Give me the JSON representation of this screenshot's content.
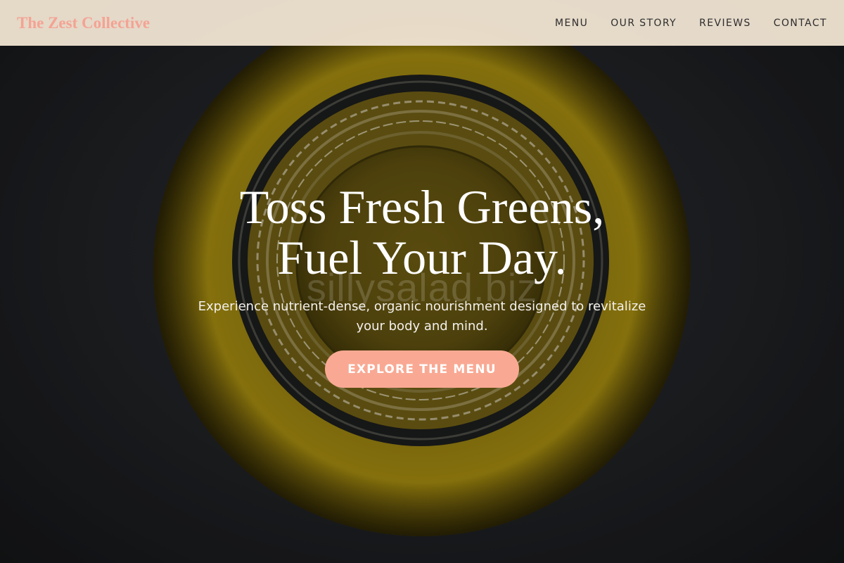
{
  "header": {
    "brand": "The Zest Collective",
    "nav": [
      {
        "label": "MENU"
      },
      {
        "label": "OUR STORY"
      },
      {
        "label": "REVIEWS"
      },
      {
        "label": "CONTACT"
      }
    ]
  },
  "hero": {
    "title_line1": "Toss Fresh Greens,",
    "title_line2": "Fuel Your Day.",
    "subtitle": "Experience nutrient-dense, organic nourishment designed to revitalize your body and mind.",
    "cta_label": "EXPLORE THE MENU",
    "watermark": "sillysalad.biz"
  },
  "colors": {
    "brand": "#f4a394",
    "cta_background": "#f9a993",
    "header_background": "#eee2d0",
    "jar_yellow": "#8f7a12"
  }
}
